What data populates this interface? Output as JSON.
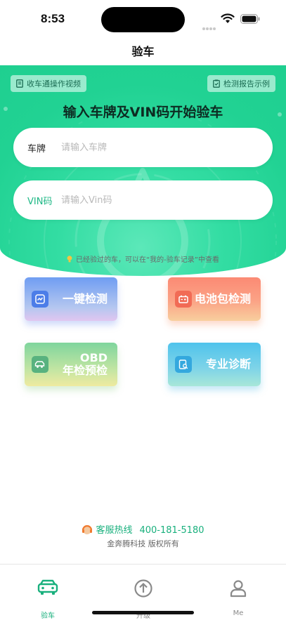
{
  "status_bar": {
    "time": "8:53"
  },
  "nav": {
    "title": "验车"
  },
  "hero": {
    "video_link": "收车通操作视频",
    "report_link": "检测报告示例",
    "title": "输入车牌及VIN码开始验车",
    "plate": {
      "label": "车牌",
      "placeholder": "请输入车牌",
      "value": ""
    },
    "vin": {
      "label": "VIN码",
      "placeholder": "请输入Vin码",
      "value": ""
    }
  },
  "hint": "已经验过的车，可以在“我的-验车记录”中查看",
  "tiles": [
    {
      "label": "一键检测",
      "icon": "quick-check-icon"
    },
    {
      "label": "电池包检测",
      "icon": "battery-icon"
    },
    {
      "label_line1": "OBD",
      "label_line2": "年检预检",
      "icon": "obd-car-icon"
    },
    {
      "label": "专业诊断",
      "icon": "diagnosis-doc-icon"
    }
  ],
  "footer": {
    "hotline_label": "客服热线",
    "hotline_number": "400-181-5180",
    "copyright": "金奔腾科技 版权所有"
  },
  "tabbar": {
    "items": [
      {
        "label": "验车",
        "icon": "car-icon",
        "active": true
      },
      {
        "label": "升级",
        "icon": "upload-arrow-icon",
        "active": false
      },
      {
        "label": "Me",
        "icon": "person-icon",
        "active": false
      }
    ]
  },
  "colors": {
    "accent": "#1fcf90",
    "accent_text": "#19b07d"
  }
}
